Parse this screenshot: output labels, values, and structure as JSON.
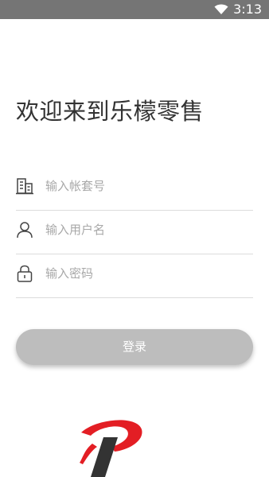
{
  "status_bar": {
    "time": "3:13",
    "wifi_icon": "wifi-icon"
  },
  "title": "欢迎来到乐檬零售",
  "fields": [
    {
      "icon": "building-icon",
      "placeholder": "输入帐套号"
    },
    {
      "icon": "user-icon",
      "placeholder": "输入用户名"
    },
    {
      "icon": "lock-icon",
      "placeholder": "输入密码"
    }
  ],
  "login_button": {
    "label": "登录",
    "color": "#bdbdbd"
  },
  "logo": {
    "icon": "lemon-logo",
    "accent": "#e31e24"
  }
}
